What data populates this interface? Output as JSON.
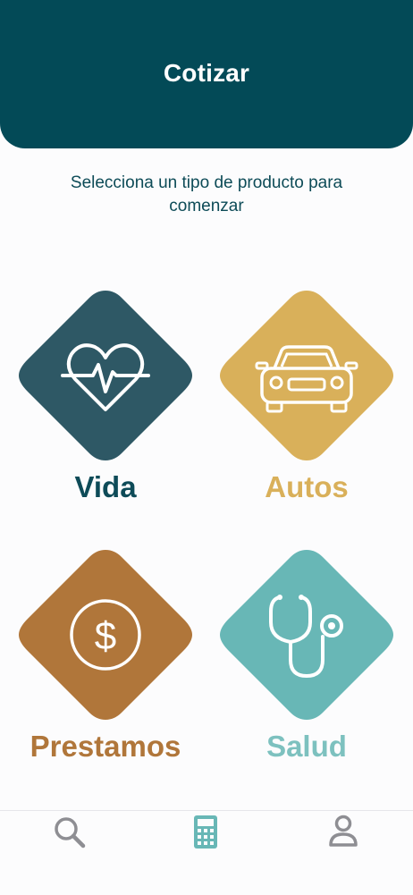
{
  "header": {
    "title": "Cotizar"
  },
  "subtitle": "Selecciona un tipo de producto para comenzar",
  "products": [
    {
      "label": "Vida",
      "icon": "heart-pulse-icon",
      "color": "#2e5865",
      "label_color": "#0e4b58"
    },
    {
      "label": "Autos",
      "icon": "car-icon",
      "color": "#d9b05a",
      "label_color": "#d9b05a"
    },
    {
      "label": "Prestamos",
      "icon": "dollar-coin-icon",
      "color": "#b0763a",
      "label_color": "#b0763a"
    },
    {
      "label": "Salud",
      "icon": "stethoscope-icon",
      "color": "#68b7b6",
      "label_color": "#7dc1bf"
    }
  ],
  "tabbar": {
    "items": [
      {
        "icon": "search-icon",
        "active": false
      },
      {
        "icon": "calculator-icon",
        "active": true
      },
      {
        "icon": "profile-icon",
        "active": false
      }
    ],
    "active_color": "#68b7b6",
    "inactive_color": "#8e8e93"
  }
}
